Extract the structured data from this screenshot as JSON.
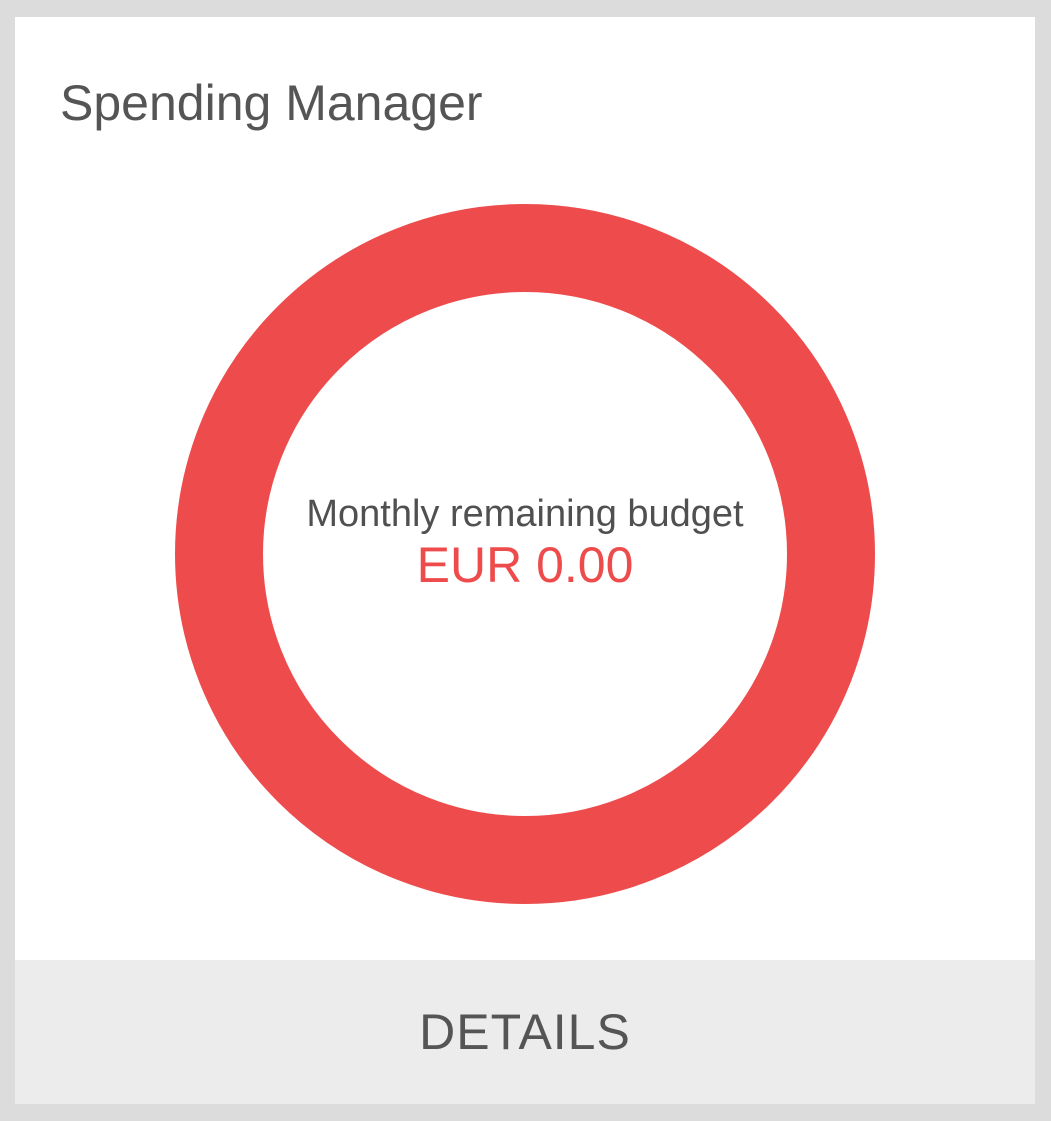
{
  "widget": {
    "title": "Spending Manager",
    "budget_label": "Monthly remaining budget",
    "budget_value": "EUR 0.00",
    "remaining_fraction": 0,
    "ring_color": "#ee4c4c",
    "details_label": "DETAILS"
  }
}
